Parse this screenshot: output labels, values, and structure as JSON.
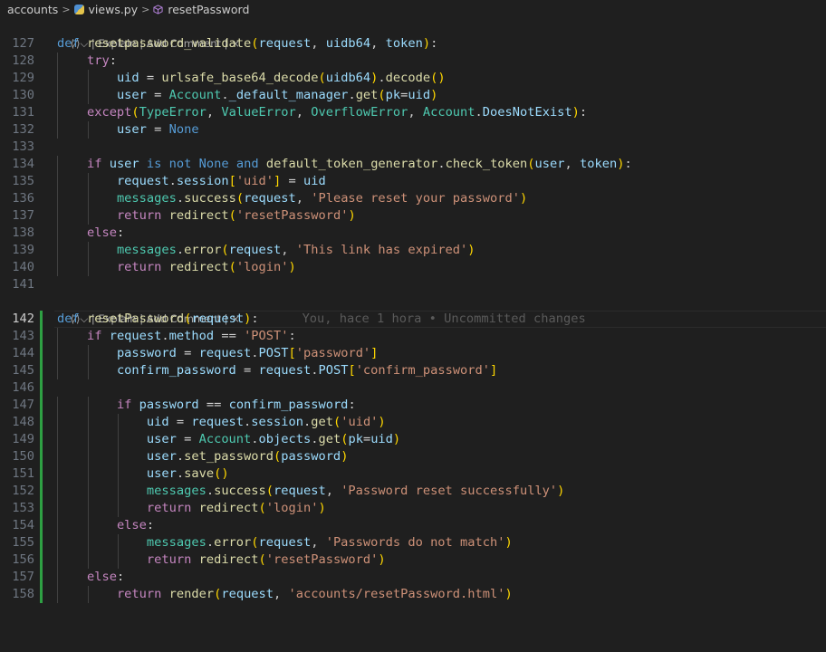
{
  "breadcrumb": {
    "folder": "accounts",
    "file": "views.py",
    "symbol": "resetPassword"
  },
  "codelens": {
    "icon_glyph": "⟨⁄⟩⌵",
    "explain": "Explain",
    "add_comment": "Add Comment",
    "close": "×"
  },
  "blame": "You, hace 1 hora • Uncommitted changes",
  "colors": {
    "background": "#1f1f1f",
    "keyword": "#569cd6",
    "control": "#c586c0",
    "function": "#dcdcaa",
    "variable": "#9cdcfe",
    "class": "#4ec9b0",
    "string": "#ce9178",
    "added_bar": "#2ea043"
  },
  "lines": [
    {
      "n": "127",
      "t": [
        [
          "kw",
          "def"
        ],
        [
          "pl",
          " "
        ],
        [
          "fn",
          "resetpassword_validate"
        ],
        [
          "br1",
          "("
        ],
        [
          "var",
          "request"
        ],
        [
          "pl",
          ", "
        ],
        [
          "var",
          "uidb64"
        ],
        [
          "pl",
          ", "
        ],
        [
          "var",
          "token"
        ],
        [
          "br1",
          ")"
        ],
        [
          "pl",
          ":"
        ]
      ]
    },
    {
      "n": "128",
      "t": [
        [
          "pl",
          "    "
        ],
        [
          "ctl",
          "try"
        ],
        [
          "pl",
          ":"
        ]
      ]
    },
    {
      "n": "129",
      "t": [
        [
          "pl",
          "        "
        ],
        [
          "var",
          "uid"
        ],
        [
          "op",
          " = "
        ],
        [
          "fn",
          "urlsafe_base64_decode"
        ],
        [
          "br1",
          "("
        ],
        [
          "var",
          "uidb64"
        ],
        [
          "br1",
          ")"
        ],
        [
          "pl",
          "."
        ],
        [
          "fn",
          "decode"
        ],
        [
          "br1",
          "()"
        ]
      ]
    },
    {
      "n": "130",
      "t": [
        [
          "pl",
          "        "
        ],
        [
          "var",
          "user"
        ],
        [
          "op",
          " = "
        ],
        [
          "cls",
          "Account"
        ],
        [
          "pl",
          "."
        ],
        [
          "var",
          "_default_manager"
        ],
        [
          "pl",
          "."
        ],
        [
          "fn",
          "get"
        ],
        [
          "br1",
          "("
        ],
        [
          "var",
          "pk"
        ],
        [
          "op",
          "="
        ],
        [
          "var",
          "uid"
        ],
        [
          "br1",
          ")"
        ]
      ]
    },
    {
      "n": "131",
      "t": [
        [
          "pl",
          "    "
        ],
        [
          "ctl",
          "except"
        ],
        [
          "br1",
          "("
        ],
        [
          "cls",
          "TypeError"
        ],
        [
          "pl",
          ", "
        ],
        [
          "cls",
          "ValueError"
        ],
        [
          "pl",
          ", "
        ],
        [
          "cls",
          "OverflowError"
        ],
        [
          "pl",
          ", "
        ],
        [
          "cls",
          "Account"
        ],
        [
          "pl",
          "."
        ],
        [
          "var",
          "DoesNotExist"
        ],
        [
          "br1",
          ")"
        ],
        [
          "pl",
          ":"
        ]
      ]
    },
    {
      "n": "132",
      "t": [
        [
          "pl",
          "        "
        ],
        [
          "var",
          "user"
        ],
        [
          "op",
          " = "
        ],
        [
          "kw",
          "None"
        ]
      ]
    },
    {
      "n": "133",
      "t": []
    },
    {
      "n": "134",
      "t": [
        [
          "pl",
          "    "
        ],
        [
          "ctl",
          "if"
        ],
        [
          "pl",
          " "
        ],
        [
          "var",
          "user"
        ],
        [
          "pl",
          " "
        ],
        [
          "kw",
          "is not"
        ],
        [
          "pl",
          " "
        ],
        [
          "kw",
          "None"
        ],
        [
          "pl",
          " "
        ],
        [
          "kw",
          "and"
        ],
        [
          "pl",
          " "
        ],
        [
          "fn",
          "default_token_generator"
        ],
        [
          "pl",
          "."
        ],
        [
          "fn",
          "check_token"
        ],
        [
          "br1",
          "("
        ],
        [
          "var",
          "user"
        ],
        [
          "pl",
          ", "
        ],
        [
          "var",
          "token"
        ],
        [
          "br1",
          ")"
        ],
        [
          "pl",
          ":"
        ]
      ]
    },
    {
      "n": "135",
      "t": [
        [
          "pl",
          "        "
        ],
        [
          "var",
          "request"
        ],
        [
          "pl",
          "."
        ],
        [
          "var",
          "session"
        ],
        [
          "br1",
          "["
        ],
        [
          "str",
          "'uid'"
        ],
        [
          "br1",
          "]"
        ],
        [
          "op",
          " = "
        ],
        [
          "var",
          "uid"
        ]
      ]
    },
    {
      "n": "136",
      "t": [
        [
          "pl",
          "        "
        ],
        [
          "cls",
          "messages"
        ],
        [
          "pl",
          "."
        ],
        [
          "fn",
          "success"
        ],
        [
          "br1",
          "("
        ],
        [
          "var",
          "request"
        ],
        [
          "pl",
          ", "
        ],
        [
          "str",
          "'Please reset your password'"
        ],
        [
          "br1",
          ")"
        ]
      ]
    },
    {
      "n": "137",
      "t": [
        [
          "pl",
          "        "
        ],
        [
          "ctl",
          "return"
        ],
        [
          "pl",
          " "
        ],
        [
          "fn",
          "redirect"
        ],
        [
          "br1",
          "("
        ],
        [
          "str",
          "'resetPassword'"
        ],
        [
          "br1",
          ")"
        ]
      ]
    },
    {
      "n": "138",
      "t": [
        [
          "pl",
          "    "
        ],
        [
          "ctl",
          "else"
        ],
        [
          "pl",
          ":"
        ]
      ]
    },
    {
      "n": "139",
      "t": [
        [
          "pl",
          "        "
        ],
        [
          "cls",
          "messages"
        ],
        [
          "pl",
          "."
        ],
        [
          "fn",
          "error"
        ],
        [
          "br1",
          "("
        ],
        [
          "var",
          "request"
        ],
        [
          "pl",
          ", "
        ],
        [
          "str",
          "'This link has expired'"
        ],
        [
          "br1",
          ")"
        ]
      ]
    },
    {
      "n": "140",
      "t": [
        [
          "pl",
          "        "
        ],
        [
          "ctl",
          "return"
        ],
        [
          "pl",
          " "
        ],
        [
          "fn",
          "redirect"
        ],
        [
          "br1",
          "("
        ],
        [
          "str",
          "'login'"
        ],
        [
          "br1",
          ")"
        ]
      ]
    },
    {
      "n": "141",
      "t": []
    },
    {
      "lens": true
    },
    {
      "n": "142",
      "cur": true,
      "bar": true,
      "blame": true,
      "t": [
        [
          "kw",
          "def"
        ],
        [
          "pl",
          " "
        ],
        [
          "fn",
          "resetPassword"
        ],
        [
          "br1",
          "("
        ],
        [
          "var",
          "request"
        ],
        [
          "br1",
          ")"
        ],
        [
          "pl",
          ":"
        ]
      ]
    },
    {
      "n": "143",
      "bar": true,
      "t": [
        [
          "pl",
          "    "
        ],
        [
          "ctl",
          "if"
        ],
        [
          "pl",
          " "
        ],
        [
          "var",
          "request"
        ],
        [
          "pl",
          "."
        ],
        [
          "var",
          "method"
        ],
        [
          "op",
          " == "
        ],
        [
          "str",
          "'POST'"
        ],
        [
          "pl",
          ":"
        ]
      ]
    },
    {
      "n": "144",
      "bar": true,
      "t": [
        [
          "pl",
          "        "
        ],
        [
          "var",
          "password"
        ],
        [
          "op",
          " = "
        ],
        [
          "var",
          "request"
        ],
        [
          "pl",
          "."
        ],
        [
          "var",
          "POST"
        ],
        [
          "br1",
          "["
        ],
        [
          "str",
          "'password'"
        ],
        [
          "br1",
          "]"
        ]
      ]
    },
    {
      "n": "145",
      "bar": true,
      "t": [
        [
          "pl",
          "        "
        ],
        [
          "var",
          "confirm_password"
        ],
        [
          "op",
          " = "
        ],
        [
          "var",
          "request"
        ],
        [
          "pl",
          "."
        ],
        [
          "var",
          "POST"
        ],
        [
          "br1",
          "["
        ],
        [
          "str",
          "'confirm_password'"
        ],
        [
          "br1",
          "]"
        ]
      ]
    },
    {
      "n": "146",
      "bar": true,
      "t": []
    },
    {
      "n": "147",
      "bar": true,
      "t": [
        [
          "pl",
          "        "
        ],
        [
          "ctl",
          "if"
        ],
        [
          "pl",
          " "
        ],
        [
          "var",
          "password"
        ],
        [
          "op",
          " == "
        ],
        [
          "var",
          "confirm_password"
        ],
        [
          "pl",
          ":"
        ]
      ]
    },
    {
      "n": "148",
      "bar": true,
      "t": [
        [
          "pl",
          "            "
        ],
        [
          "var",
          "uid"
        ],
        [
          "op",
          " = "
        ],
        [
          "var",
          "request"
        ],
        [
          "pl",
          "."
        ],
        [
          "var",
          "session"
        ],
        [
          "pl",
          "."
        ],
        [
          "fn",
          "get"
        ],
        [
          "br1",
          "("
        ],
        [
          "str",
          "'uid'"
        ],
        [
          "br1",
          ")"
        ]
      ]
    },
    {
      "n": "149",
      "bar": true,
      "t": [
        [
          "pl",
          "            "
        ],
        [
          "var",
          "user"
        ],
        [
          "op",
          " = "
        ],
        [
          "cls",
          "Account"
        ],
        [
          "pl",
          "."
        ],
        [
          "var",
          "objects"
        ],
        [
          "pl",
          "."
        ],
        [
          "fn",
          "get"
        ],
        [
          "br1",
          "("
        ],
        [
          "var",
          "pk"
        ],
        [
          "op",
          "="
        ],
        [
          "var",
          "uid"
        ],
        [
          "br1",
          ")"
        ]
      ]
    },
    {
      "n": "150",
      "bar": true,
      "t": [
        [
          "pl",
          "            "
        ],
        [
          "var",
          "user"
        ],
        [
          "pl",
          "."
        ],
        [
          "fn",
          "set_password"
        ],
        [
          "br1",
          "("
        ],
        [
          "var",
          "password"
        ],
        [
          "br1",
          ")"
        ]
      ]
    },
    {
      "n": "151",
      "bar": true,
      "t": [
        [
          "pl",
          "            "
        ],
        [
          "var",
          "user"
        ],
        [
          "pl",
          "."
        ],
        [
          "fn",
          "save"
        ],
        [
          "br1",
          "()"
        ]
      ]
    },
    {
      "n": "152",
      "bar": true,
      "t": [
        [
          "pl",
          "            "
        ],
        [
          "cls",
          "messages"
        ],
        [
          "pl",
          "."
        ],
        [
          "fn",
          "success"
        ],
        [
          "br1",
          "("
        ],
        [
          "var",
          "request"
        ],
        [
          "pl",
          ", "
        ],
        [
          "str",
          "'Password reset successfully'"
        ],
        [
          "br1",
          ")"
        ]
      ]
    },
    {
      "n": "153",
      "bar": true,
      "t": [
        [
          "pl",
          "            "
        ],
        [
          "ctl",
          "return"
        ],
        [
          "pl",
          " "
        ],
        [
          "fn",
          "redirect"
        ],
        [
          "br1",
          "("
        ],
        [
          "str",
          "'login'"
        ],
        [
          "br1",
          ")"
        ]
      ]
    },
    {
      "n": "154",
      "bar": true,
      "t": [
        [
          "pl",
          "        "
        ],
        [
          "ctl",
          "else"
        ],
        [
          "pl",
          ":"
        ]
      ]
    },
    {
      "n": "155",
      "bar": true,
      "t": [
        [
          "pl",
          "            "
        ],
        [
          "cls",
          "messages"
        ],
        [
          "pl",
          "."
        ],
        [
          "fn",
          "error"
        ],
        [
          "br1",
          "("
        ],
        [
          "var",
          "request"
        ],
        [
          "pl",
          ", "
        ],
        [
          "str",
          "'Passwords do not match'"
        ],
        [
          "br1",
          ")"
        ]
      ]
    },
    {
      "n": "156",
      "bar": true,
      "t": [
        [
          "pl",
          "            "
        ],
        [
          "ctl",
          "return"
        ],
        [
          "pl",
          " "
        ],
        [
          "fn",
          "redirect"
        ],
        [
          "br1",
          "("
        ],
        [
          "str",
          "'resetPassword'"
        ],
        [
          "br1",
          ")"
        ]
      ]
    },
    {
      "n": "157",
      "bar": true,
      "t": [
        [
          "pl",
          "    "
        ],
        [
          "ctl",
          "else"
        ],
        [
          "pl",
          ":"
        ]
      ]
    },
    {
      "n": "158",
      "bar": true,
      "t": [
        [
          "pl",
          "        "
        ],
        [
          "ctl",
          "return"
        ],
        [
          "pl",
          " "
        ],
        [
          "fn",
          "render"
        ],
        [
          "br1",
          "("
        ],
        [
          "var",
          "request"
        ],
        [
          "pl",
          ", "
        ],
        [
          "str",
          "'accounts/resetPassword.html'"
        ],
        [
          "br1",
          ")"
        ]
      ]
    }
  ]
}
